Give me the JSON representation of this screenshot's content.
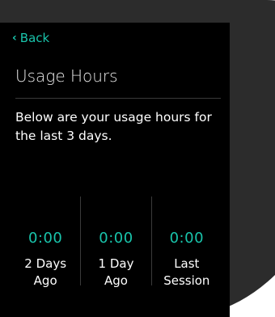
{
  "nav": {
    "back_label": "Back"
  },
  "page": {
    "title": "Usage Hours",
    "description": "Below are your usage hours for the last 3 days."
  },
  "usage": [
    {
      "value": "0:00",
      "label": "2 Days\nAgo"
    },
    {
      "value": "0:00",
      "label": "1 Day\nAgo"
    },
    {
      "value": "0:00",
      "label": "Last\nSession"
    }
  ],
  "colors": {
    "accent": "#19c4ab",
    "screen_background": "#000000",
    "bezel": "#2c2c2c"
  }
}
